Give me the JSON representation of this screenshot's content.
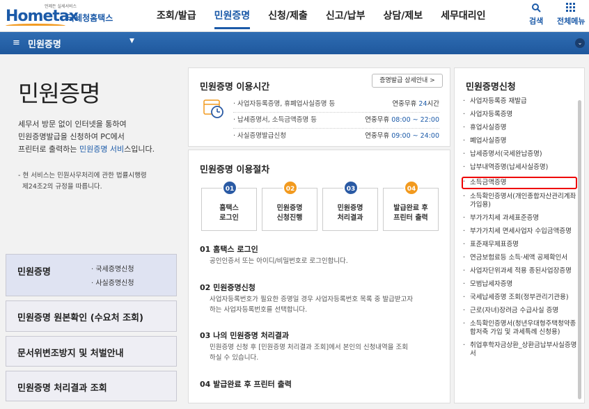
{
  "header": {
    "logo_tagline": "언제든 실세서비스",
    "logo_main": "Hometax",
    "logo_sub": "국세청홈택스",
    "nav": [
      "조회/발급",
      "민원증명",
      "신청/제출",
      "신고/납부",
      "상담/제보",
      "세무대리인"
    ],
    "search_label": "검색",
    "allmenu_label": "전체메뉴"
  },
  "section_bar": {
    "title": "민원증명"
  },
  "intro": {
    "title": "민원증명",
    "desc_line1": "세무서 방문 없이 인터넷을 통하여",
    "desc_line2": "민원증명발급을 신청하여 PC에서",
    "desc_line3a": "프린터로 출력하는 ",
    "desc_line3b": "민원증명 서비",
    "desc_line3c": "스입니다.",
    "note_line1": "- 현 서비스는 민원사무처리에 관한 법률시행령",
    "note_line2": "  제24조2의 규정을 따릅니다."
  },
  "left_menu": {
    "box1_title": "민원증명",
    "box1_sub1": "· 국세증명신청",
    "box1_sub2": "· 사실증명신청",
    "box2_title": "민원증명 원본확인 (수요처 조회)",
    "box3_title": "문서위변조방지 및 처벌안내",
    "box4_title": "민원증명 처리결과 조회"
  },
  "hours": {
    "title": "민원증명 이용시간",
    "detail_button": "증명발급 상세안내 >",
    "rows": [
      {
        "label": "· 사업자등록증명, 휴폐업사실증명 등",
        "pre": "연중무휴 ",
        "hl": "24",
        "post": "시간"
      },
      {
        "label": "· 납세증명서, 소득금액증명 등",
        "pre": "연중무휴 ",
        "hl": "08:00 ~ 22:00",
        "post": ""
      },
      {
        "label": "· 사실증명발급신청",
        "pre": "연중무휴 ",
        "hl": "09:00 ~ 24:00",
        "post": ""
      }
    ]
  },
  "procedure": {
    "title": "민원증명 이용절차",
    "steps": [
      {
        "num": "01",
        "line1": "홈택스",
        "line2": "로그인",
        "color": "blue"
      },
      {
        "num": "02",
        "line1": "민원증명",
        "line2": "신청진행",
        "color": "orange"
      },
      {
        "num": "03",
        "line1": "민원증명",
        "line2": "처리결과",
        "color": "blue"
      },
      {
        "num": "04",
        "line1": "발급완료 후",
        "line2": "프린터 출력",
        "color": "orange"
      }
    ],
    "details": [
      {
        "head": "01 홈택스 로그인",
        "line1": "공인인증서 또는 아이디/비밀번호로 로그인합니다.",
        "line2": ""
      },
      {
        "head": "02 민원증명신청",
        "line1": "사업자등록번호가 필요한 증명일 경우 사업자등록번호 목록 중 발급받고자",
        "line2": "하는 사업자등록번호를 선택합니다."
      },
      {
        "head": "03 나의 민원증명 처리결과",
        "line1": "민원증명 신청 후 [민원증명 처리결과 조회]에서 본인의 신청내역을 조회",
        "line2": "하실 수 있습니다."
      },
      {
        "head": "04 발급완료 후 프린터 출력",
        "line1": "",
        "line2": ""
      }
    ]
  },
  "apply": {
    "title": "민원증명신청",
    "items": [
      "사업자등록증 재발급",
      "사업자등록증명",
      "휴업사실증명",
      "폐업사실증명",
      "납세증명서(국세완납증명)",
      "납부내역증명(납세사실증명)",
      "소득금액증명",
      "소득확인증명서(개인종합자산관리계좌 가입용)",
      "부가가치세 과세표준증명",
      "부가가치세 면세사업자 수입금액증명",
      "표준재무제표증명",
      "연금보험료등 소득·세액 공제확인서",
      "사업자단위과세 적용 종된사업장증명",
      "모범납세자증명",
      "국세납세증명 조회(정부관리기관용)",
      "근로(자녀)장려금 수급사실 증명",
      "소득확인증명서(청년우대형주택청약종합저축 가입 및 과세특례 신청용)",
      "취업후학자금상환_상환금납부사실증명서"
    ],
    "selected_index": 6
  }
}
